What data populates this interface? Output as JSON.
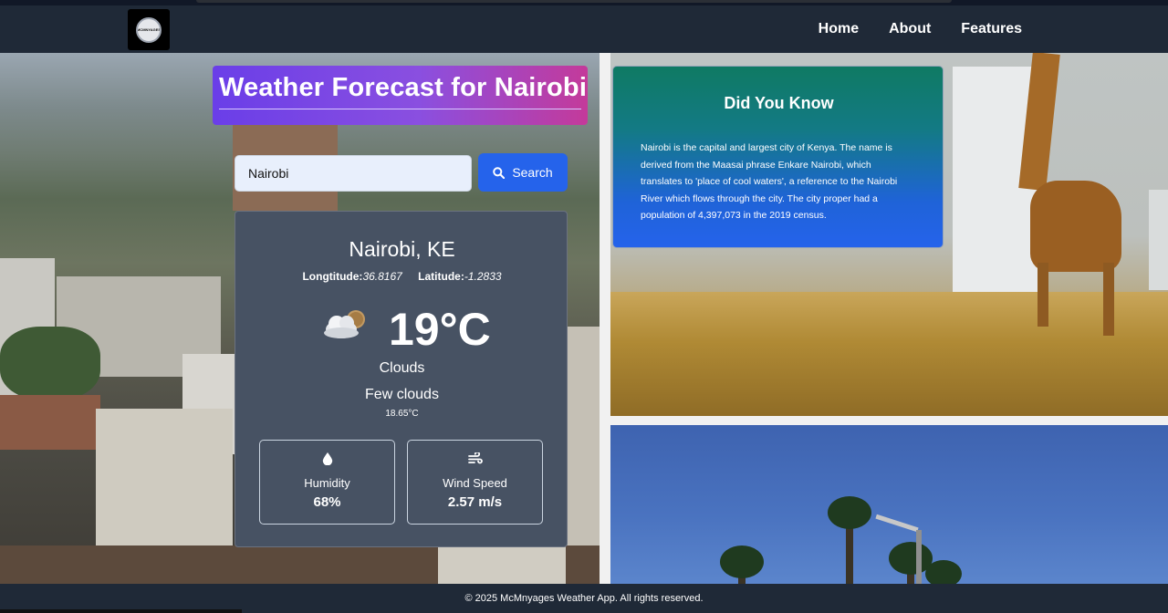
{
  "nav": {
    "logo_text": "MCMNYAGES",
    "links": [
      "Home",
      "About",
      "Features"
    ]
  },
  "title": "Weather Forecast for Nairobi",
  "search": {
    "value": "Nairobi",
    "button_label": "Search"
  },
  "weather": {
    "location": "Nairobi, KE",
    "longitude_label": "Longtitude:",
    "longitude_value": "36.8167",
    "latitude_label": "Latitude:",
    "latitude_value": "-1.2833",
    "icon": "cloud-sun-icon",
    "temperature": "19°C",
    "condition": "Clouds",
    "description": "Few clouds",
    "exact_temp": "18.65°C",
    "humidity_label": "Humidity",
    "humidity_value": "68%",
    "wind_label": "Wind Speed",
    "wind_value": "2.57 m/s"
  },
  "did_you_know": {
    "title": "Did You Know",
    "text": "Nairobi is the capital and largest city of Kenya. The name is derived from the Maasai phrase Enkare Nairobi, which translates to 'place of cool waters', a reference to the Nairobi River which flows through the city. The city proper had a population of 4,397,073 in the 2019 census."
  },
  "footer": "© 2025 McMnyages Weather App. All rights reserved.",
  "colors": {
    "navbar": "#1f2937",
    "search_button": "#2563eb",
    "card": "#475263",
    "title_gradient_start": "#6a3ee8",
    "title_gradient_end": "#c43a9a"
  }
}
